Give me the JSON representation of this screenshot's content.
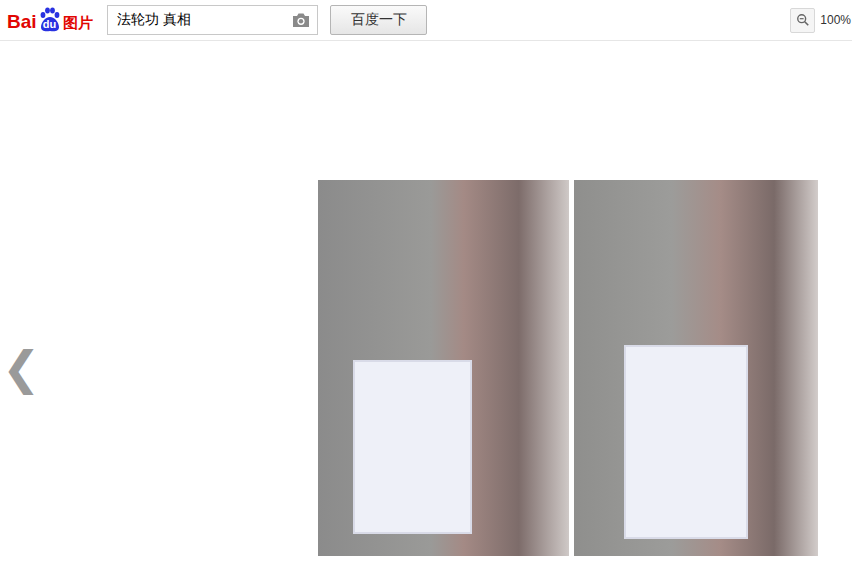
{
  "logo": {
    "text_left": "Bai",
    "text_paw": "du",
    "text_right": "图片"
  },
  "search": {
    "value": "法轮功 真相",
    "button": "百度一下"
  },
  "zoom": {
    "reading": "100%"
  },
  "viewer": {
    "prev": "❮"
  }
}
